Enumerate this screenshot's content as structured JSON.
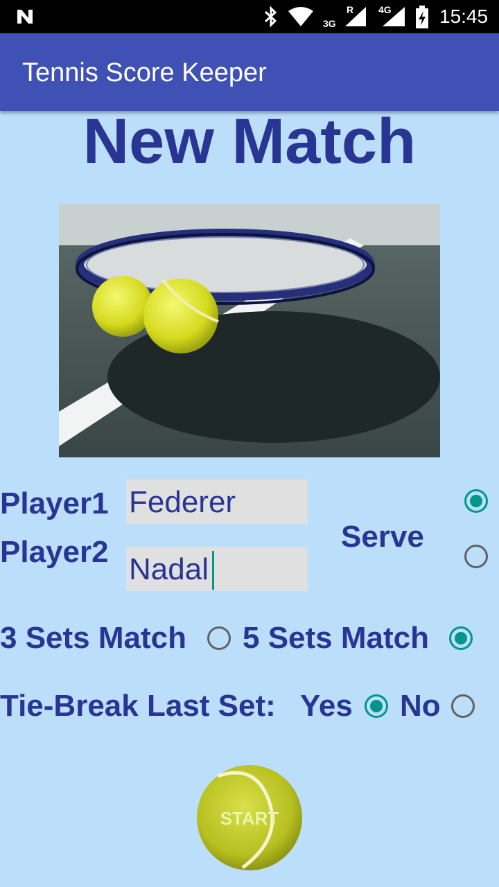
{
  "status_bar": {
    "time": "15:45",
    "network_3g": "3G",
    "roaming": "R",
    "network_4g": "4G"
  },
  "app_bar": {
    "title": "Tennis Score Keeper"
  },
  "heading": "New Match",
  "players": {
    "player1_label": "Player1",
    "player1_value": "Federer",
    "player2_label": "Player2",
    "player2_value": "Nadal",
    "serve_label": "Serve",
    "serve_selected": "player1"
  },
  "sets": {
    "three_label": "3 Sets Match",
    "five_label": "5 Sets Match",
    "selected": "5"
  },
  "tiebreak": {
    "label": "Tie-Break Last Set:",
    "yes_label": "Yes",
    "no_label": "No",
    "selected": "yes"
  },
  "start_button": {
    "label": "START"
  },
  "colors": {
    "background": "#bbdefb",
    "app_bar": "#3f51b5",
    "text": "#283593",
    "accent": "#009688"
  }
}
